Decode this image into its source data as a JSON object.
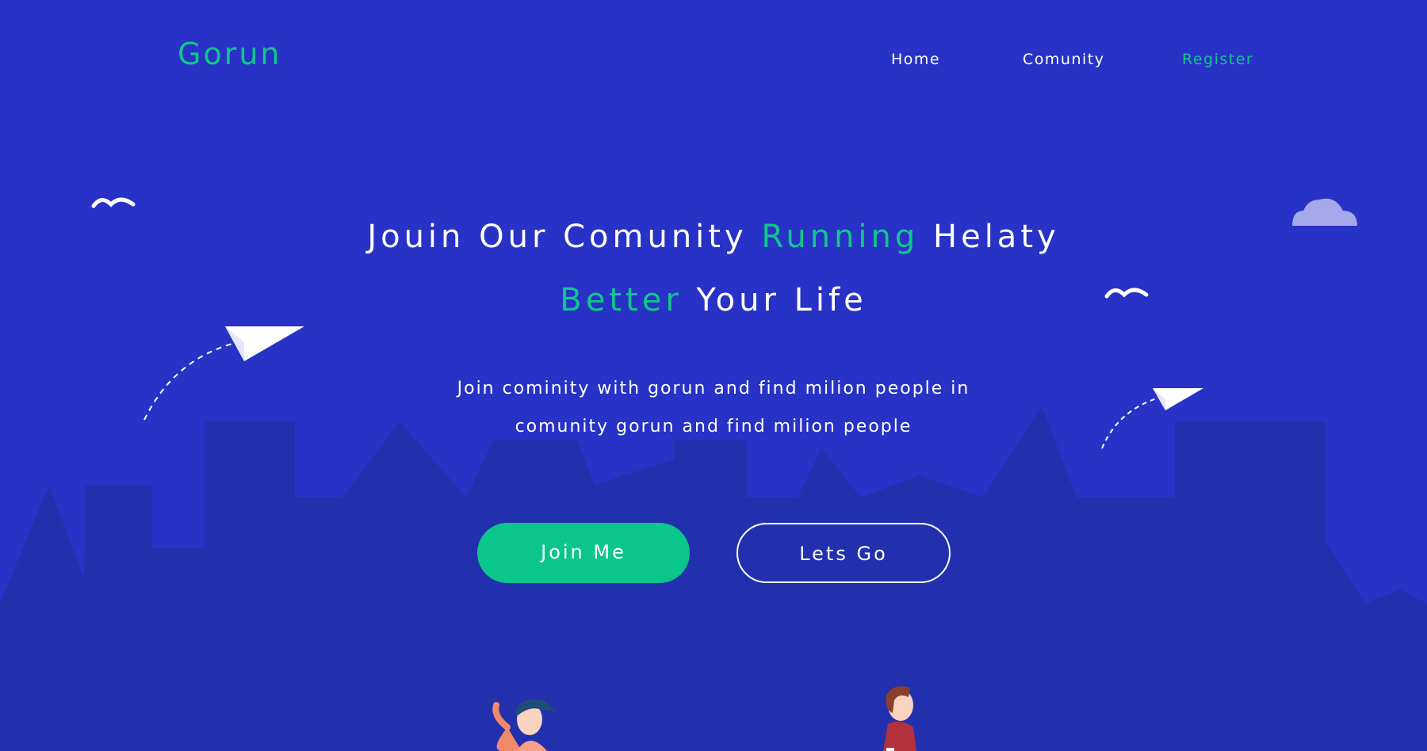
{
  "brand": {
    "logo": "Gorun"
  },
  "nav": {
    "items": [
      {
        "label": "Home",
        "active": false
      },
      {
        "label": "Comunity",
        "active": false
      },
      {
        "label": "Register",
        "active": true
      }
    ]
  },
  "hero": {
    "line1_a": "Jouin Our Comunity",
    "line1_b": "Running",
    "line1_c": "Helaty",
    "line2_a": "Better",
    "line2_b": "Your Life",
    "sub_line1": "Join cominity with gorun and find milion people in",
    "sub_line2": "comunity gorun and find milion people"
  },
  "buttons": {
    "primary": "Join Me",
    "secondary": "Lets Go"
  },
  "colors": {
    "background": "#2832c6",
    "city": "#2230ad",
    "accent": "#11c68c",
    "text": "#ffffff"
  }
}
